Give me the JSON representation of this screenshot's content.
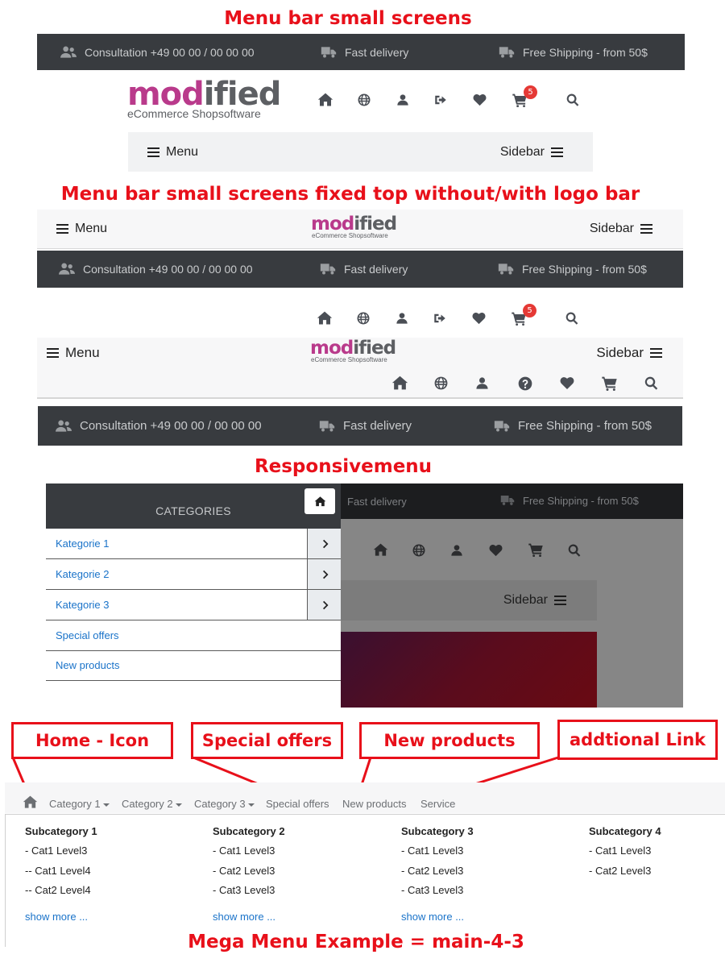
{
  "colors": {
    "accent": "#e8101a",
    "dark_bar": "#383b3f",
    "link": "#1a73c9",
    "logo_pink": "#b93a8b",
    "badge": "#e53935"
  },
  "titles": {
    "t1": "Menu bar small screens",
    "t2": "Menu bar small screens fixed top without/with logo bar",
    "t3": "Responsivemenu",
    "t4": "Mega Menu Example = main-4-3"
  },
  "info_bar": {
    "consultation": "Consultation +49 00 00 / 00 00 00",
    "fast_delivery": "Fast delivery",
    "free_shipping": "Free Shipping - from 50$"
  },
  "logo": {
    "part1": "mod",
    "part2": "ified",
    "tagline": "eCommerce Shopsoftware"
  },
  "cart_badge": "5",
  "menu_bar": {
    "menu": "Menu",
    "sidebar": "Sidebar"
  },
  "icons": [
    "home-icon",
    "globe-icon",
    "user-icon",
    "logout-icon",
    "heart-icon",
    "cart-icon",
    "search-icon",
    "help-icon",
    "users-icon",
    "truck-icon",
    "chevron-right-icon",
    "menu-icon"
  ],
  "responsive_menu": {
    "header": "CATEGORIES",
    "items": [
      "Kategorie 1",
      "Kategorie 2",
      "Kategorie 3",
      "Special offers",
      "New products"
    ],
    "overlay_fast_delivery": "Fast delivery",
    "overlay_free_shipping": "Free Shipping - from 50$",
    "overlay_sidebar": "Sidebar"
  },
  "annotations": {
    "home_icon": "Home - Icon",
    "special_offers": "Special offers",
    "new_products": "New products",
    "additional_link": "addtional Link"
  },
  "mega_menu": {
    "nav": {
      "cat1": "Category 1",
      "cat2": "Category 2",
      "cat3": "Category 3",
      "special": "Special offers",
      "new": "New products",
      "service": "Service"
    },
    "columns": [
      {
        "title": "Subcategory 1",
        "items": [
          "- Cat1 Level3",
          "-- Cat1 Level4",
          "-- Cat2 Level4"
        ],
        "more": "show more ..."
      },
      {
        "title": "Subcategory 2",
        "items": [
          "- Cat1 Level3",
          "- Cat2 Level3",
          "- Cat3 Level3"
        ],
        "more": "show more ..."
      },
      {
        "title": "Subcategory 3",
        "items": [
          "- Cat1 Level3",
          "- Cat2 Level3",
          "- Cat3 Level3"
        ],
        "more": "show more ..."
      },
      {
        "title": "Subcategory 4",
        "items": [
          "- Cat1 Level3",
          "- Cat2 Level3"
        ],
        "more": ""
      }
    ]
  }
}
